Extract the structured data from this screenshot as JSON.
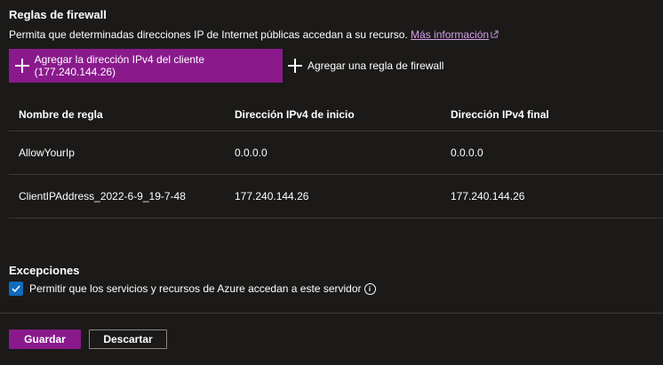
{
  "firewall": {
    "title": "Reglas de firewall",
    "description": "Permita que determinadas direcciones IP de Internet públicas accedan a su recurso.",
    "learn_more": "Más información",
    "add_client_ip_label": "Agregar la dirección IPv4 del cliente (177.240.144.26)",
    "add_rule_label": "Agregar una regla de firewall"
  },
  "table": {
    "headers": [
      "Nombre de regla",
      "Dirección IPv4 de inicio",
      "Dirección IPv4 final"
    ],
    "rows": [
      [
        "AllowYourIp",
        "0.0.0.0",
        "0.0.0.0"
      ],
      [
        "ClientIPAddress_2022-6-9_19-7-48",
        "177.240.144.26",
        "177.240.144.26"
      ]
    ]
  },
  "exceptions": {
    "title": "Excepciones",
    "allow_azure_label": "Permitir que los servicios y recursos de Azure accedan a este servidor",
    "allow_azure_checked": true
  },
  "footer": {
    "save_label": "Guardar",
    "discard_label": "Descartar"
  },
  "colors": {
    "accent": "#8a1a8c",
    "checkbox": "#0f6cbd",
    "background": "#1b1a19"
  }
}
